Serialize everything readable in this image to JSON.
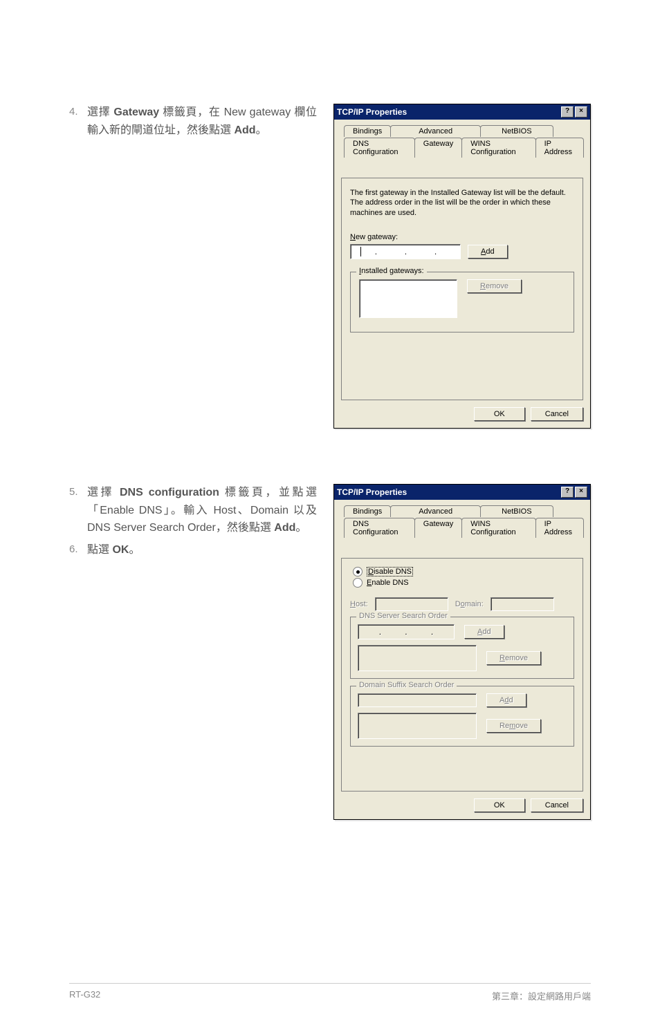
{
  "instructions": {
    "step4": {
      "num": "4.",
      "text_a": "選擇 ",
      "text_b": "Gateway",
      "text_c": " 標籤頁，在 New gateway 欄位輸入新的閘道位址，然後點選 ",
      "text_d": "Add",
      "text_e": "。"
    },
    "step5": {
      "num": "5.",
      "text_a": "選擇 ",
      "text_b": "DNS configuration",
      "text_c": " 標籤頁，並點選「Enable DNS」。輸入 Host、Domain 以及 DNS Server Search Order，然後點選 ",
      "text_d": "Add",
      "text_e": "。"
    },
    "step6": {
      "num": "6.",
      "text_a": "點選 ",
      "text_b": "OK",
      "text_c": "。"
    }
  },
  "dialog1": {
    "title": "TCP/IP Properties",
    "tabs_back": [
      "Bindings",
      "Advanced",
      "NetBIOS"
    ],
    "tabs_front": [
      "DNS Configuration",
      "Gateway",
      "WINS Configuration",
      "IP Address"
    ],
    "info": "The first gateway in the Installed Gateway list will be the default. The address order in the list will be the order in which these machines are used.",
    "new_gateway_label": "New gateway:",
    "add_btn": "Add",
    "installed_label": "Installed gateways:",
    "remove_btn": "Remove",
    "ok": "OK",
    "cancel": "Cancel"
  },
  "dialog2": {
    "title": "TCP/IP Properties",
    "tabs_back": [
      "Bindings",
      "Advanced",
      "NetBIOS"
    ],
    "tabs_front": [
      "DNS Configuration",
      "Gateway",
      "WINS Configuration",
      "IP Address"
    ],
    "disable_dns": "Disable DNS",
    "enable_dns": "Enable DNS",
    "host": "Host:",
    "domain": "Domain:",
    "dns_search": "DNS Server Search Order",
    "add_btn": "Add",
    "remove_btn": "Remove",
    "domain_suffix": "Domain Suffix Search Order",
    "ok": "OK",
    "cancel": "Cancel"
  },
  "footer": {
    "left": "RT-G32",
    "right": "第三章：設定網路用戶端"
  }
}
